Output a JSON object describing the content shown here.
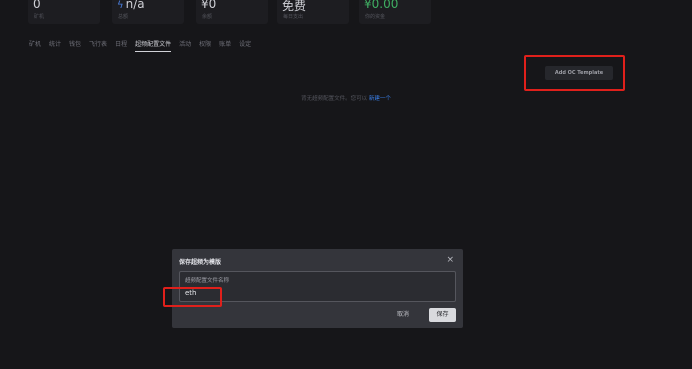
{
  "stats": [
    {
      "value": "0",
      "label": "矿机",
      "icon": "",
      "value_color": "default"
    },
    {
      "value": "n/a",
      "label": "总额",
      "icon": "bolt-icon",
      "value_color": "default"
    },
    {
      "value": "¥0",
      "label": "余额",
      "icon": "",
      "value_color": "default"
    },
    {
      "value": "免费",
      "label": "每日支出",
      "icon": "",
      "value_color": "default"
    },
    {
      "value": "¥0.00",
      "label": "你的资金",
      "icon": "",
      "value_color": "#3fae62"
    }
  ],
  "tabs": [
    {
      "label": "矿机",
      "active": false
    },
    {
      "label": "统计",
      "active": false
    },
    {
      "label": "钱包",
      "active": false
    },
    {
      "label": "飞行表",
      "active": false
    },
    {
      "label": "日程",
      "active": false
    },
    {
      "label": "超频配置文件",
      "active": true
    },
    {
      "label": "活动",
      "active": false
    },
    {
      "label": "权限",
      "active": false
    },
    {
      "label": "账单",
      "active": false
    },
    {
      "label": "设定",
      "active": false
    }
  ],
  "add_template_label": "Add OC Template",
  "empty_state": {
    "text": "背无超频配置文件。您可以",
    "link": "新建一个"
  },
  "dialog": {
    "title": "保存超频为模版",
    "field_label": "超频配置文件名称",
    "field_value": "eth",
    "cancel_label": "取消",
    "save_label": "保存"
  },
  "colors": {
    "background": "#161619",
    "highlight": "#e0201b",
    "link": "#3a7ee6",
    "positive": "#3fae62"
  }
}
